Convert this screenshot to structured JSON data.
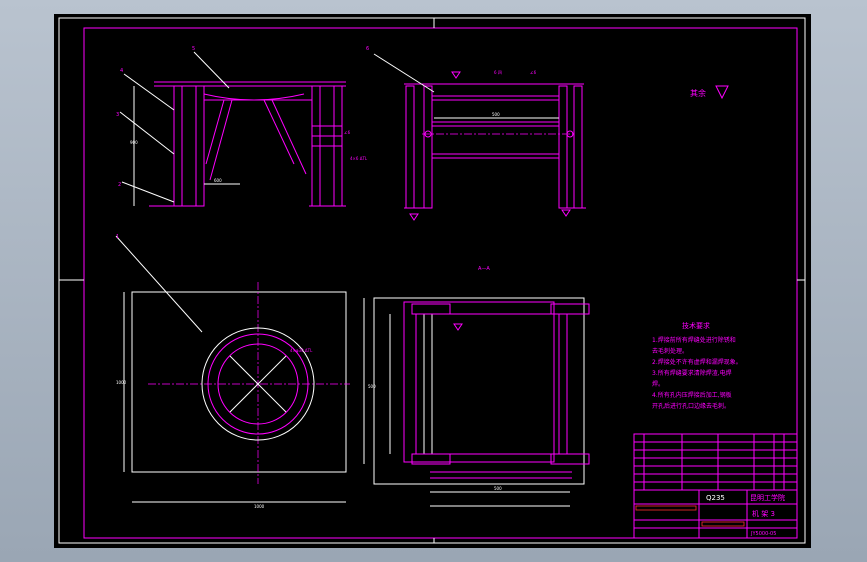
{
  "drawing": {
    "section_label": "A—A",
    "rough_other_label": "其余",
    "tech_title": "技术要求",
    "tech_lines": [
      "1.焊接前所有焊缝处进行除锈和",
      "去毛刺处理。",
      "2.焊接处不许有虚焊和漏焊现象。",
      "3.所有焊缝要求清除焊渣,电焊",
      "焊。",
      "4.所有孔内压焊接后加工,钢板",
      "开孔后进行孔口边缘去毛刺。"
    ],
    "title_block": {
      "material": "Q235",
      "school": "昆明工学院",
      "name": "机 架 3",
      "drawing_no": "JY5000-05"
    },
    "callouts": [
      "1",
      "2",
      "3",
      "4",
      "5",
      "6"
    ],
    "dims": {
      "plan_width": "1000",
      "plan_height": "1000",
      "front_span": "600",
      "side_span": "500"
    }
  }
}
